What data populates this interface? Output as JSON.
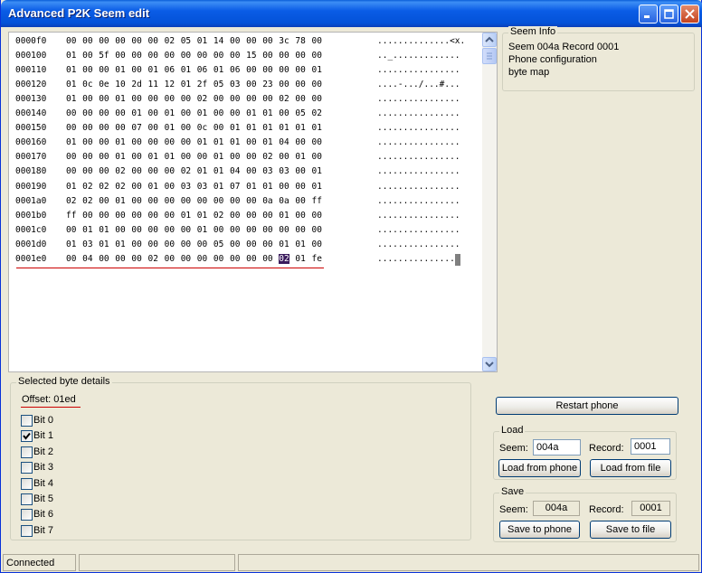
{
  "window": {
    "title": "Advanced P2K Seem edit"
  },
  "hex_rows": [
    {
      "offset": "0000f0",
      "bytes": [
        "00",
        "00",
        "00",
        "00",
        "00",
        "00",
        "02",
        "05",
        "01",
        "14",
        "00",
        "00",
        "00",
        "3c",
        "78",
        "00"
      ],
      "ascii": "..............<x."
    },
    {
      "offset": "000100",
      "bytes": [
        "01",
        "00",
        "5f",
        "00",
        "00",
        "00",
        "00",
        "00",
        "00",
        "00",
        "00",
        "15",
        "00",
        "00",
        "00",
        "00"
      ],
      "ascii": ".._............."
    },
    {
      "offset": "000110",
      "bytes": [
        "01",
        "00",
        "00",
        "01",
        "00",
        "01",
        "06",
        "01",
        "06",
        "01",
        "06",
        "00",
        "00",
        "00",
        "00",
        "01"
      ],
      "ascii": "................"
    },
    {
      "offset": "000120",
      "bytes": [
        "01",
        "0c",
        "0e",
        "10",
        "2d",
        "11",
        "12",
        "01",
        "2f",
        "05",
        "03",
        "00",
        "23",
        "00",
        "00",
        "00"
      ],
      "ascii": "....-.../...#..."
    },
    {
      "offset": "000130",
      "bytes": [
        "01",
        "00",
        "00",
        "01",
        "00",
        "00",
        "00",
        "00",
        "02",
        "00",
        "00",
        "00",
        "00",
        "02",
        "00",
        "00"
      ],
      "ascii": "................"
    },
    {
      "offset": "000140",
      "bytes": [
        "00",
        "00",
        "00",
        "00",
        "01",
        "00",
        "01",
        "00",
        "01",
        "00",
        "00",
        "01",
        "01",
        "00",
        "05",
        "02"
      ],
      "ascii": "................"
    },
    {
      "offset": "000150",
      "bytes": [
        "00",
        "00",
        "00",
        "00",
        "07",
        "00",
        "01",
        "00",
        "0c",
        "00",
        "01",
        "01",
        "01",
        "01",
        "01",
        "01"
      ],
      "ascii": "................"
    },
    {
      "offset": "000160",
      "bytes": [
        "01",
        "00",
        "00",
        "01",
        "00",
        "00",
        "00",
        "00",
        "01",
        "01",
        "01",
        "00",
        "01",
        "04",
        "00",
        "00"
      ],
      "ascii": "................"
    },
    {
      "offset": "000170",
      "bytes": [
        "00",
        "00",
        "00",
        "01",
        "00",
        "01",
        "01",
        "00",
        "00",
        "01",
        "00",
        "00",
        "02",
        "00",
        "01",
        "00"
      ],
      "ascii": "................"
    },
    {
      "offset": "000180",
      "bytes": [
        "00",
        "00",
        "00",
        "02",
        "00",
        "00",
        "00",
        "02",
        "01",
        "01",
        "04",
        "00",
        "03",
        "03",
        "00",
        "01"
      ],
      "ascii": "................"
    },
    {
      "offset": "000190",
      "bytes": [
        "01",
        "02",
        "02",
        "02",
        "00",
        "01",
        "00",
        "03",
        "03",
        "01",
        "07",
        "01",
        "01",
        "00",
        "00",
        "01"
      ],
      "ascii": "................"
    },
    {
      "offset": "0001a0",
      "bytes": [
        "02",
        "02",
        "00",
        "01",
        "00",
        "00",
        "00",
        "00",
        "00",
        "00",
        "00",
        "00",
        "0a",
        "0a",
        "00",
        "ff"
      ],
      "ascii": "................"
    },
    {
      "offset": "0001b0",
      "bytes": [
        "ff",
        "00",
        "00",
        "00",
        "00",
        "00",
        "00",
        "01",
        "01",
        "02",
        "00",
        "00",
        "00",
        "01",
        "00",
        "00"
      ],
      "ascii": "................"
    },
    {
      "offset": "0001c0",
      "bytes": [
        "00",
        "01",
        "01",
        "00",
        "00",
        "00",
        "00",
        "00",
        "01",
        "00",
        "00",
        "00",
        "00",
        "00",
        "00",
        "00"
      ],
      "ascii": "................"
    },
    {
      "offset": "0001d0",
      "bytes": [
        "01",
        "03",
        "01",
        "01",
        "00",
        "00",
        "00",
        "00",
        "00",
        "05",
        "00",
        "00",
        "00",
        "01",
        "01",
        "00"
      ],
      "ascii": "................"
    },
    {
      "offset": "0001e0",
      "bytes": [
        "00",
        "04",
        "00",
        "00",
        "00",
        "02",
        "00",
        "00",
        "00",
        "00",
        "00",
        "00",
        "00",
        "02",
        "01",
        "fe"
      ],
      "ascii": "................"
    }
  ],
  "selection": {
    "row": 15,
    "col": 13
  },
  "seem_info": {
    "legend": "Seem Info",
    "lines": [
      "Seem 004a Record 0001",
      "Phone configuration",
      "byte map"
    ]
  },
  "details": {
    "legend": "Selected byte details",
    "offset_label": "Offset: 01ed",
    "bits": [
      {
        "label": "Bit 0",
        "checked": false
      },
      {
        "label": "Bit 1",
        "checked": true
      },
      {
        "label": "Bit 2",
        "checked": false
      },
      {
        "label": "Bit 3",
        "checked": false
      },
      {
        "label": "Bit 4",
        "checked": false
      },
      {
        "label": "Bit 5",
        "checked": false
      },
      {
        "label": "Bit 6",
        "checked": false
      },
      {
        "label": "Bit 7",
        "checked": false
      }
    ]
  },
  "restart_label": "Restart phone",
  "load": {
    "legend": "Load",
    "seem_label": "Seem:",
    "seem_value": "004a",
    "record_label": "Record:",
    "record_value": "0001",
    "from_phone": "Load from phone",
    "from_file": "Load from file"
  },
  "save": {
    "legend": "Save",
    "seem_label": "Seem:",
    "seem_value": "004a",
    "record_label": "Record:",
    "record_value": "0001",
    "to_phone": "Save to phone",
    "to_file": "Save to file"
  },
  "status": {
    "text": "Connected",
    "panel2": "",
    "panel3": ""
  }
}
